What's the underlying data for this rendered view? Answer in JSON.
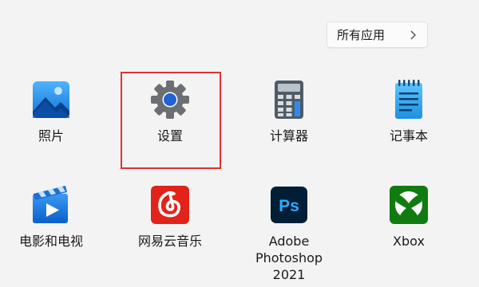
{
  "all_apps_button": {
    "label": "所有应用",
    "chevron": "chevron-right-icon"
  },
  "apps": [
    {
      "label": "照片",
      "icon": "photos-icon"
    },
    {
      "label": "设置",
      "icon": "settings-gear-icon"
    },
    {
      "label": "计算器",
      "icon": "calculator-icon"
    },
    {
      "label": "记事本",
      "icon": "notepad-icon"
    },
    {
      "label": "电影和电视",
      "icon": "movies-tv-icon"
    },
    {
      "label": "网易云音乐",
      "icon": "netease-music-icon"
    },
    {
      "label": "Adobe\nPhotoshop 2021",
      "icon": "photoshop-icon"
    },
    {
      "label": "Xbox",
      "icon": "xbox-icon"
    }
  ],
  "highlight": {
    "color": "#e0302f",
    "target": "设置"
  }
}
